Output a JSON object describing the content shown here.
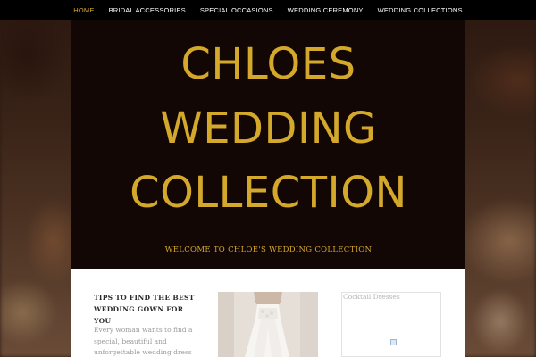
{
  "colors": {
    "accent": "#d4a82a",
    "nav_background": "#000000",
    "hero_background": "#120705",
    "content_background": "#ffffff"
  },
  "nav": {
    "items": [
      {
        "label": "HOME",
        "active": true
      },
      {
        "label": "BRIDAL ACCESSORIES",
        "active": false
      },
      {
        "label": "SPECIAL OCCASIONS",
        "active": false
      },
      {
        "label": "WEDDING CEREMONY",
        "active": false
      },
      {
        "label": "WEDDING COLLECTIONS",
        "active": false
      }
    ]
  },
  "hero": {
    "title_line1": "CHLOES",
    "title_line2": "WEDDING",
    "title_line3": "COLLECTION",
    "tagline": "WELCOME TO CHLOE'S WEDDING COLLECTION"
  },
  "post": {
    "title_line1": "TIPS TO FIND THE BEST",
    "title_line2": "WEDDING GOWN FOR YOU",
    "excerpt_line1": "Every woman wants to find a",
    "excerpt_line2": "special, beautiful and",
    "excerpt_line3": "unforgettable wedding dress at"
  },
  "widget": {
    "title": "Cocktail Dresses",
    "image_icon": "broken-image-icon"
  }
}
